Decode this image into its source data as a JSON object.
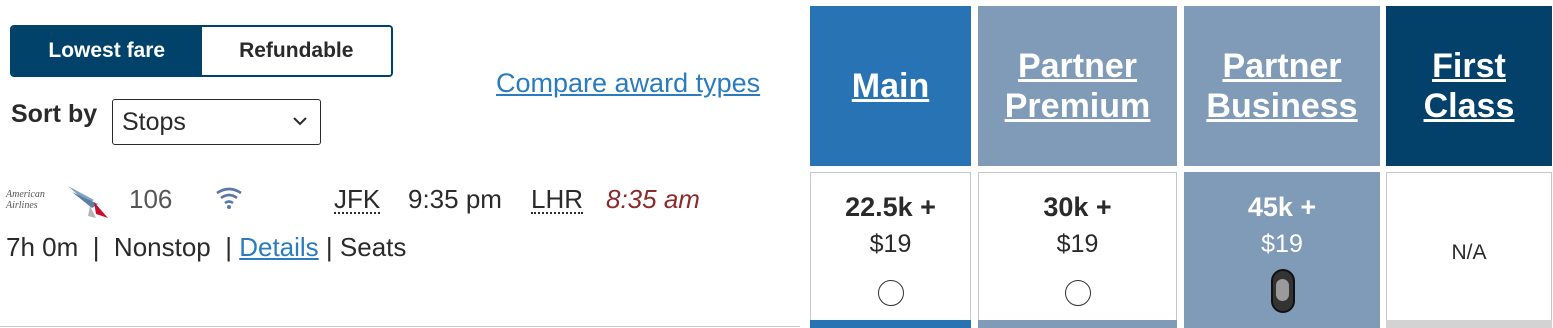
{
  "fare_toggle": {
    "lowest": "Lowest fare",
    "refundable": "Refundable"
  },
  "compare_link": "Compare award types",
  "sort": {
    "label": "Sort by",
    "value": "Stops"
  },
  "flight": {
    "airline_logo_text": "American Airlines",
    "flight_number": "106",
    "wifi_icon": "wifi-icon",
    "origin": "JFK",
    "depart_time": "9:35 pm",
    "destination": "LHR",
    "arrive_time": "8:35 am",
    "duration": "7h 0m",
    "sep1": "  |  ",
    "stops": "Nonstop",
    "sep2": "  | ",
    "details_link": "Details",
    "sep3": " | ",
    "seats": "Seats"
  },
  "fare_columns": [
    {
      "header_line1": "Main",
      "header_line2": "",
      "points": "22.5k +",
      "fee": "$19",
      "selected": false,
      "available": true
    },
    {
      "header_line1": "Partner",
      "header_line2": "Premium",
      "points": "30k +",
      "fee": "$19",
      "selected": false,
      "available": true
    },
    {
      "header_line1": "Partner",
      "header_line2": "Business",
      "points": "45k +",
      "fee": "$19",
      "selected": true,
      "available": true
    },
    {
      "header_line1": "First",
      "header_line2": "Class",
      "points": "",
      "fee": "",
      "selected": false,
      "available": false,
      "na_label": "N/A"
    }
  ],
  "colors": {
    "brand_navy": "#01426a",
    "main_blue": "#2873b4",
    "partner_grey_blue": "#7f9bb7",
    "first_class_navy": "#03416a",
    "link_blue": "#2a7bbf",
    "arrival_red": "#8b2b2b"
  }
}
